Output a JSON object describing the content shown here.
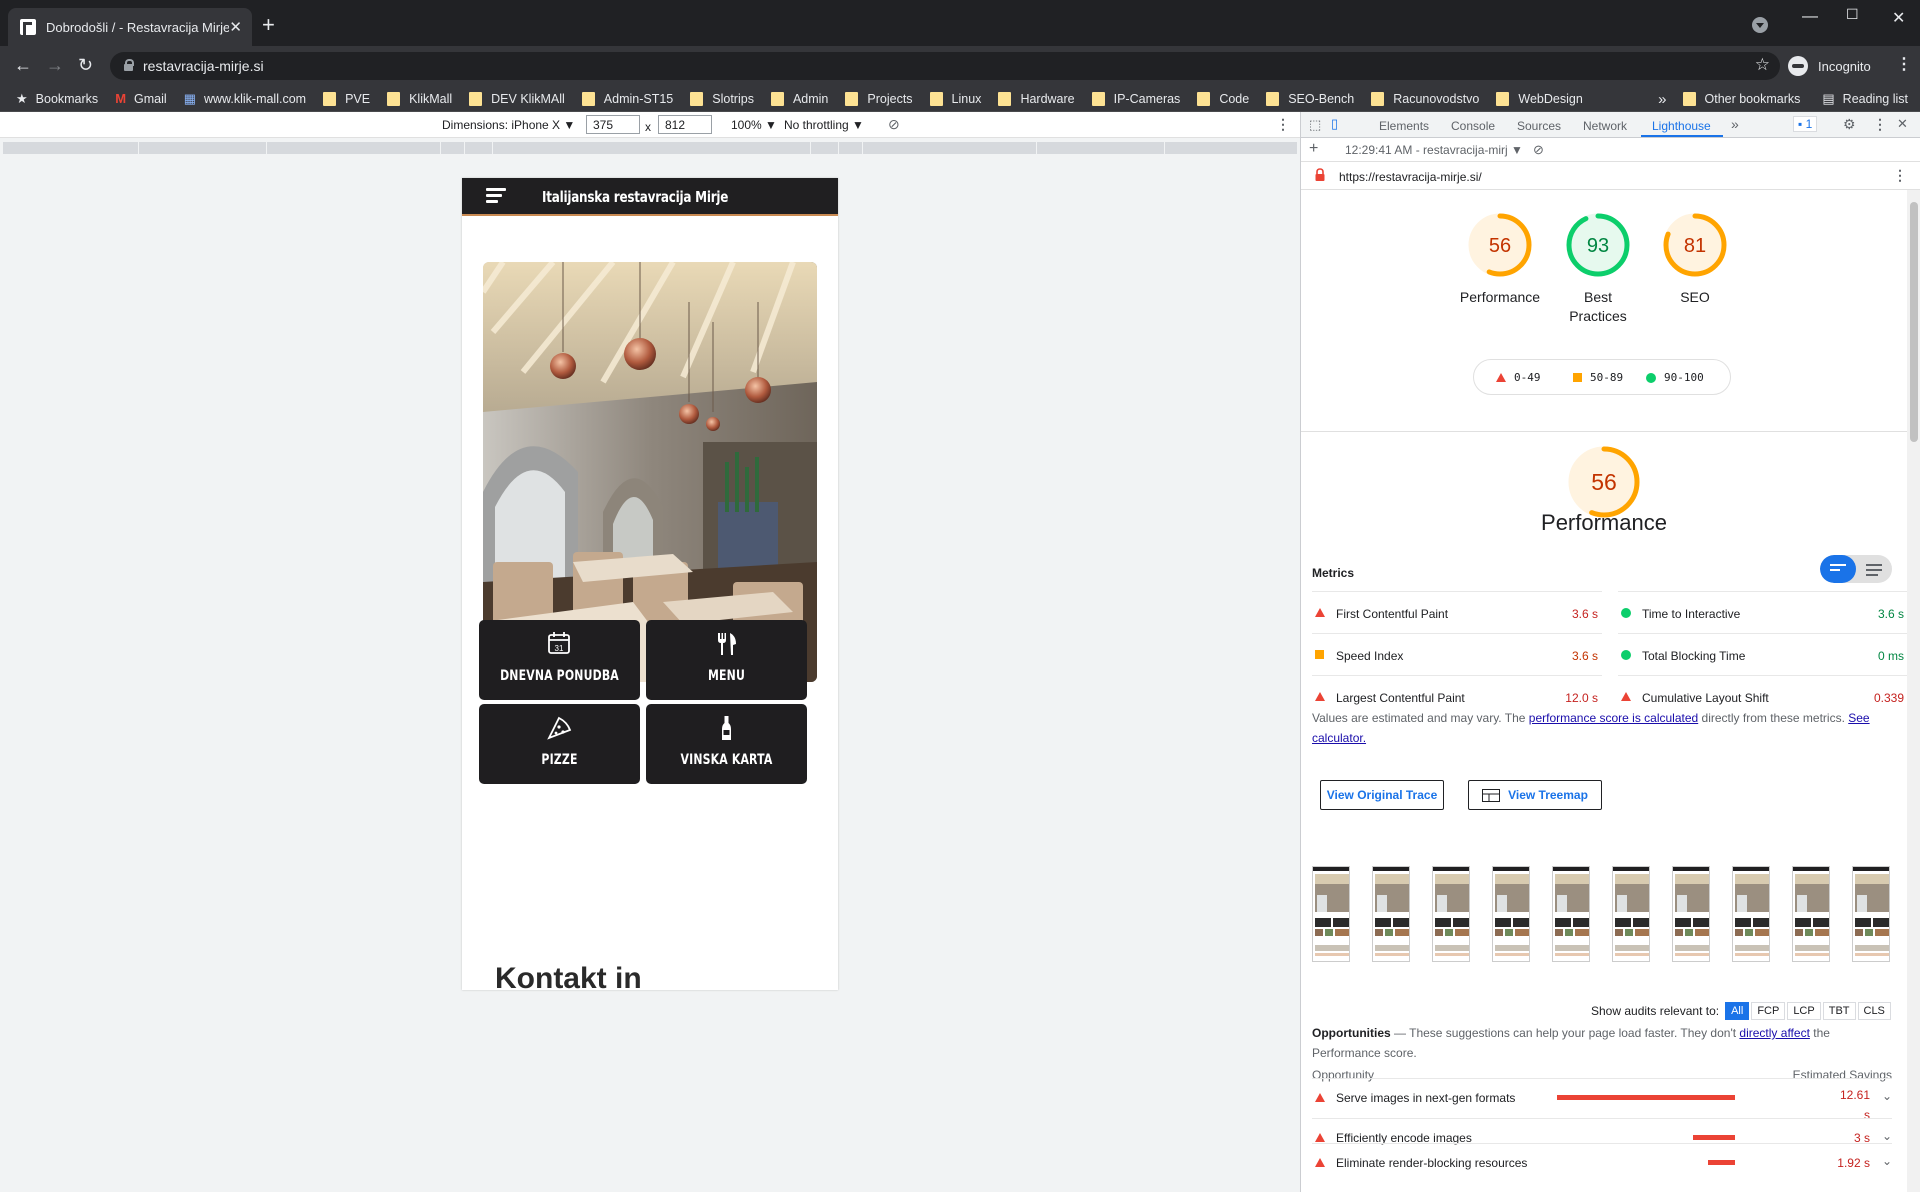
{
  "browser": {
    "tab_title": "Dobrodošli / - Restavracija Mirje",
    "url": "restavracija-mirje.si",
    "profile_label": "Incognito",
    "bookmarks": [
      {
        "label": "Bookmarks",
        "type": "star"
      },
      {
        "label": "Gmail",
        "type": "gmail"
      },
      {
        "label": "www.klik-mall.com",
        "type": "site"
      },
      {
        "label": "PVE",
        "type": "folder"
      },
      {
        "label": "KlikMall",
        "type": "folder"
      },
      {
        "label": "DEV KlikMAll",
        "type": "folder"
      },
      {
        "label": "Admin-ST15",
        "type": "folder"
      },
      {
        "label": "Slotrips",
        "type": "folder"
      },
      {
        "label": "Admin",
        "type": "folder"
      },
      {
        "label": "Projects",
        "type": "folder"
      },
      {
        "label": "Linux",
        "type": "folder"
      },
      {
        "label": "Hardware",
        "type": "folder"
      },
      {
        "label": "IP-Cameras",
        "type": "folder"
      },
      {
        "label": "Code",
        "type": "folder"
      },
      {
        "label": "SEO-Bench",
        "type": "folder"
      },
      {
        "label": "Racunovodstvo",
        "type": "folder"
      },
      {
        "label": "WebDesign",
        "type": "folder"
      }
    ],
    "bookmarks_overflow": "»",
    "other_bookmarks": "Other bookmarks",
    "reading_list": "Reading list"
  },
  "device_toolbar": {
    "dimensions_label": "Dimensions: iPhone X ▼",
    "width": "375",
    "times": "x",
    "height": "812",
    "zoom": "100% ▼",
    "throttling": "No throttling ▼"
  },
  "site": {
    "title": "Italijanska restavracija Mirje",
    "tiles": [
      {
        "label": "DNEVNA PONUDBA",
        "icon": "calendar-icon"
      },
      {
        "label": "MENU",
        "icon": "cutlery-icon"
      },
      {
        "label": "PIZZE",
        "icon": "pizza-icon"
      },
      {
        "label": "VINSKA KARTA",
        "icon": "wine-bottle-icon"
      }
    ],
    "contact_heading": "Kontakt in"
  },
  "devtools": {
    "tabs": [
      "Elements",
      "Console",
      "Sources",
      "Network",
      "Lighthouse"
    ],
    "active_tab": "Lighthouse",
    "more_tabs": "»",
    "issues_count": "1",
    "report_label": "12:29:41 AM - restavracija-mirj ▼",
    "audited_url": "https://restavracija-mirje.si/",
    "scores": [
      {
        "label": "Performance",
        "value": 56,
        "color": "#ffa400"
      },
      {
        "label": "Best Practices",
        "value": 93,
        "color": "#0cce6b"
      },
      {
        "label": "SEO",
        "value": 81,
        "color": "#ffa400"
      }
    ],
    "legend": {
      "fail": "0-49",
      "average": "50-89",
      "pass": "90-100"
    },
    "performance_score": 56,
    "performance_title": "Performance",
    "metrics_title": "Metrics",
    "metrics": [
      {
        "name": "First Contentful Paint",
        "value": "3.6 s",
        "status": "fail"
      },
      {
        "name": "Time to Interactive",
        "value": "3.6 s",
        "status": "pass"
      },
      {
        "name": "Speed Index",
        "value": "3.6 s",
        "status": "average"
      },
      {
        "name": "Total Blocking Time",
        "value": "0 ms",
        "status": "pass"
      },
      {
        "name": "Largest Contentful Paint",
        "value": "12.0 s",
        "status": "fail"
      },
      {
        "name": "Cumulative Layout Shift",
        "value": "0.339",
        "status": "fail"
      }
    ],
    "note_prefix": "Values are estimated and may vary. The ",
    "note_link1": "performance score is calculated",
    "note_middle": " directly from these metrics. ",
    "note_link2": "See calculator.",
    "btn_trace": "View Original Trace",
    "btn_treemap": "View Treemap",
    "audit_filter_label": "Show audits relevant to:",
    "audit_filters": [
      "All",
      "FCP",
      "LCP",
      "TBT",
      "CLS"
    ],
    "opportunities_title": "Opportunities",
    "opportunities_prefix": " — These suggestions can help your page load faster. They don't ",
    "opportunities_link": "directly affect",
    "opportunities_suffix": " the Performance score.",
    "opp_col_left": "Opportunity",
    "opp_col_right": "Estimated Savings",
    "opportunities": [
      {
        "name": "Serve images in next-gen formats",
        "savings": "12.61 s",
        "savings_seconds": 12.61
      },
      {
        "name": "Efficiently encode images",
        "savings": "3 s",
        "savings_seconds": 3
      },
      {
        "name": "Eliminate render-blocking resources",
        "savings": "1.92 s",
        "savings_seconds": 1.92
      }
    ]
  }
}
